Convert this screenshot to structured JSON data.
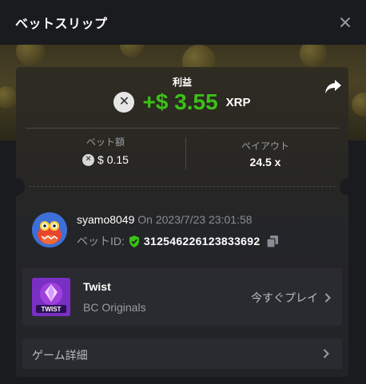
{
  "header": {
    "title": "ベットスリップ"
  },
  "profit": {
    "label": "利益",
    "amount": "+$ 3.55",
    "currency": "XRP",
    "coin_glyph": "✕"
  },
  "stats": {
    "bet_label": "ベット額",
    "bet_value": "$ 0.15",
    "payout_label": "ペイアウト",
    "payout_value": "24.5 x"
  },
  "user": {
    "name": "syamo8049",
    "on_label": "On",
    "date": "2023/7/23 23:01:58",
    "bet_id_label": "ベットID:",
    "bet_id": "312546226123833692"
  },
  "game": {
    "name": "Twist",
    "provider": "BC Originals",
    "play_label": "今すぐプレイ",
    "thumb_text": "TWIST"
  },
  "details": {
    "label": "ゲーム詳細"
  },
  "colors": {
    "profit_green": "#3bc117",
    "background": "#1a1b1f",
    "panel": "#2a2b30",
    "muted_text": "#9a9ca3"
  }
}
